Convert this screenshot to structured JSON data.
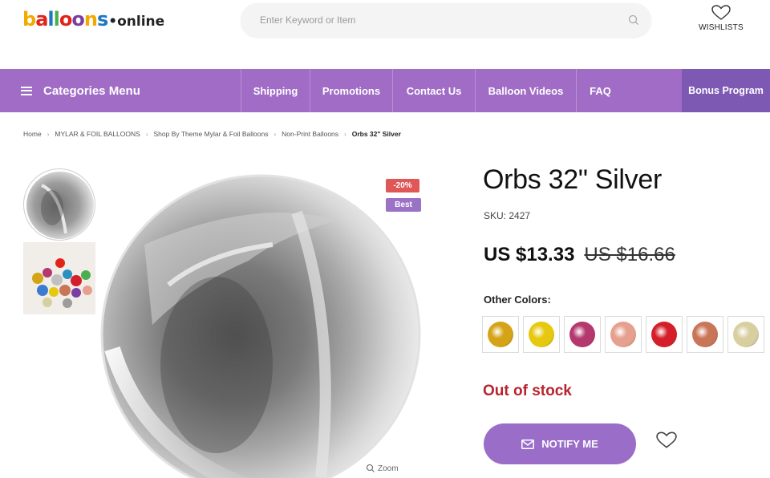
{
  "header": {
    "logo_main": "balloons",
    "logo_suffix": "•online",
    "logo_colors": [
      "#f2a900",
      "#e2231a",
      "#1d78c1",
      "#4bae4f",
      "#e2231a",
      "#7a3fa0",
      "#f2a900",
      "#1d78c1"
    ],
    "search_placeholder": "Enter Keyword or Item",
    "search_value": "",
    "wishlist_label": "WISHLISTS"
  },
  "nav": {
    "categories_label": "Categories Menu",
    "items": [
      {
        "label": "Shipping"
      },
      {
        "label": "Promotions"
      },
      {
        "label": "Contact Us"
      },
      {
        "label": "Balloon Videos"
      },
      {
        "label": "FAQ"
      }
    ],
    "bonus_label": "Bonus Program",
    "colors": {
      "bar": "#a06cc6",
      "bonus": "#7d59b4"
    }
  },
  "breadcrumb": [
    {
      "label": "Home"
    },
    {
      "label": "MYLAR & FOIL BALLOONS"
    },
    {
      "label": "Shop By Theme Mylar & Foil Balloons"
    },
    {
      "label": "Non-Print Balloons"
    },
    {
      "label": "Orbs 32\" Silver"
    }
  ],
  "product": {
    "badges": {
      "discount": "-20%",
      "best": "Best"
    },
    "zoom_label": "Zoom",
    "title": "Orbs 32\" Silver",
    "sku": "SKU: 2427",
    "price_current": "US $13.33",
    "price_old": "US $16.66",
    "other_colors_label": "Other Colors:",
    "swatches": [
      {
        "color": "gold",
        "hex": "#d4a316"
      },
      {
        "color": "yellow",
        "hex": "#e6c90f"
      },
      {
        "color": "magenta",
        "hex": "#b4386e"
      },
      {
        "color": "rose-gold",
        "hex": "#e6a08e"
      },
      {
        "color": "red",
        "hex": "#d41f2a"
      },
      {
        "color": "copper",
        "hex": "#c97558"
      },
      {
        "color": "champagne",
        "hex": "#d8cfa0"
      }
    ],
    "stock_status": "Out of stock",
    "notify_label": "NOTIFY ME",
    "accent": "#9a6ec8",
    "stock_color": "#b8242d"
  }
}
